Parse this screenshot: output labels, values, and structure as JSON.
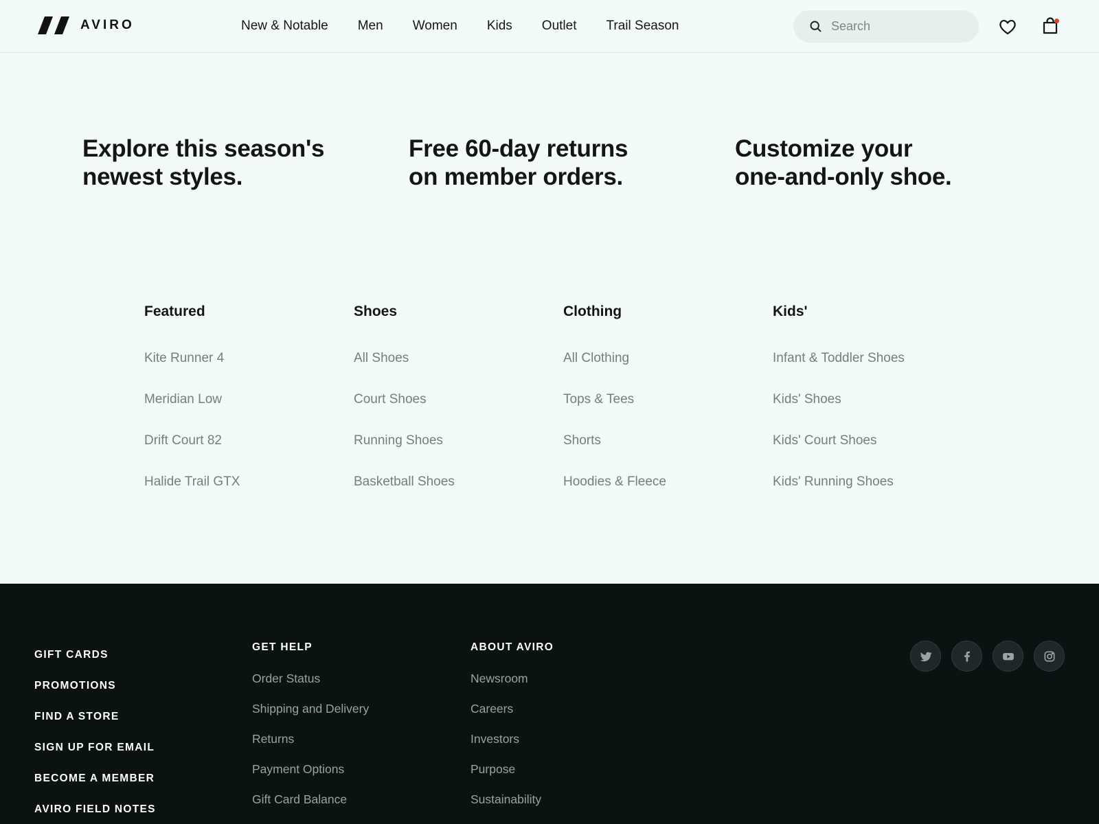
{
  "header": {
    "brand": "AVIRO",
    "nav": [
      "New & Notable",
      "Men",
      "Women",
      "Kids",
      "Outlet",
      "Trail Season"
    ],
    "search_placeholder": "Search"
  },
  "promos": [
    {
      "line1": "Explore this season's",
      "line2": "newest styles."
    },
    {
      "line1": "Free 60-day returns",
      "line2": "on member orders."
    },
    {
      "line1": "Customize your",
      "line2": "one-and-only shoe."
    }
  ],
  "menu": [
    {
      "heading": "Featured",
      "links": [
        "Kite Runner 4",
        "Meridian Low",
        "Drift Court 82",
        "Halide Trail GTX"
      ]
    },
    {
      "heading": "Shoes",
      "links": [
        "All Shoes",
        "Court Shoes",
        "Running Shoes",
        "Basketball Shoes"
      ]
    },
    {
      "heading": "Clothing",
      "links": [
        "All Clothing",
        "Tops & Tees",
        "Shorts",
        "Hoodies & Fleece"
      ]
    },
    {
      "heading": "Kids'",
      "links": [
        "Infant & Toddler Shoes",
        "Kids' Shoes",
        "Kids' Court Shoes",
        "Kids' Running Shoes"
      ]
    }
  ],
  "footer": {
    "main_links": [
      "GIFT CARDS",
      "PROMOTIONS",
      "FIND A STORE",
      "SIGN UP FOR EMAIL",
      "BECOME A MEMBER",
      "AVIRO FIELD NOTES"
    ],
    "columns": [
      {
        "heading": "GET HELP",
        "links": [
          "Order Status",
          "Shipping and Delivery",
          "Returns",
          "Payment Options",
          "Gift Card Balance"
        ]
      },
      {
        "heading": "ABOUT AVIRO",
        "links": [
          "Newsroom",
          "Careers",
          "Investors",
          "Purpose",
          "Sustainability"
        ]
      }
    ],
    "socials": [
      "twitter-icon",
      "facebook-icon",
      "youtube-icon",
      "instagram-icon"
    ]
  },
  "colors": {
    "page_bg": "#f3fbfa",
    "footer_bg": "#0b1212",
    "cart_dot": "#d6452c"
  }
}
